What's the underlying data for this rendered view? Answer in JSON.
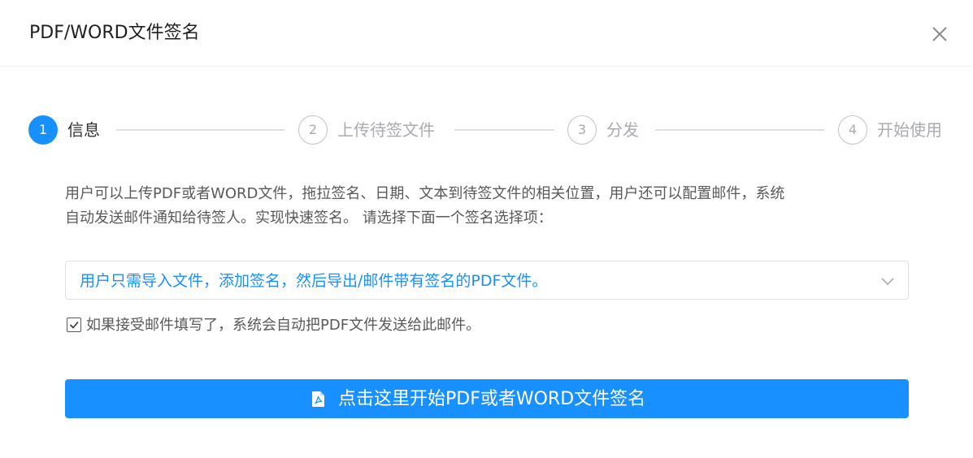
{
  "dialog": {
    "title": "PDF/WORD文件签名"
  },
  "steps": [
    {
      "number": "1",
      "label": "信息",
      "active": true
    },
    {
      "number": "2",
      "label": "上传待签文件",
      "active": false
    },
    {
      "number": "3",
      "label": "分发",
      "active": false
    },
    {
      "number": "4",
      "label": "开始使用",
      "active": false
    }
  ],
  "description": {
    "line1": "用户可以上传PDF或者WORD文件，拖拉签名、日期、文本到待签文件的相关位置，用户还可以配置邮件，系统",
    "line2": "自动发送邮件通知给待签人。实现快速签名。 请选择下面一个签名选择项："
  },
  "option_select": {
    "selected_value": "用户只需导入文件，添加签名，然后导出/邮件带有签名的PDF文件。"
  },
  "email_checkbox": {
    "checked": true,
    "label": "如果接受邮件填写了，系统会自动把PDF文件发送给此邮件。"
  },
  "start_button": {
    "label": "点击这里开始PDF或者WORD文件签名",
    "icon": "file-pdf-icon"
  },
  "colors": {
    "primary": "#1890ff",
    "text_secondary": "#595959",
    "step_inactive": "#a8abb2",
    "border": "#dcdfe6"
  }
}
